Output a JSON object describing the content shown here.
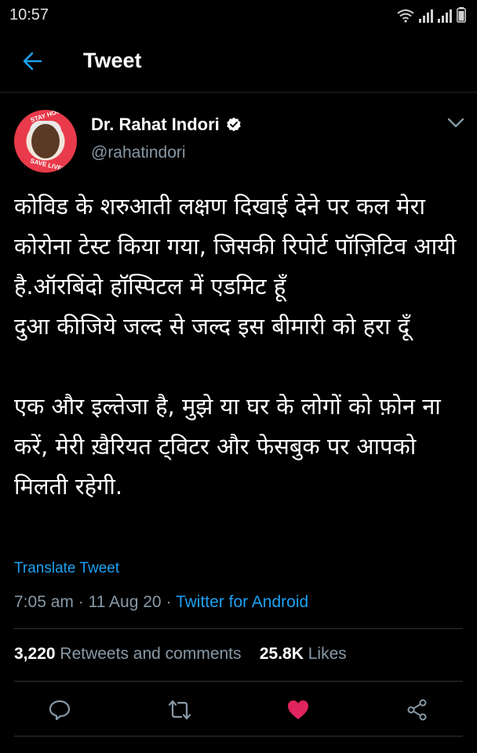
{
  "status_bar": {
    "time": "10:57"
  },
  "header": {
    "title": "Tweet"
  },
  "author": {
    "name": "Dr. Rahat Indori",
    "handle": "@rahatindori",
    "avatar_ring_text_top": "STAY HOME",
    "avatar_ring_text_bottom": "SAVE LIVES"
  },
  "tweet": {
    "paragraph1": "कोविड के शरुआती लक्षण दिखाई देने पर कल मेरा कोरोना टेस्ट किया गया, जिसकी रिपोर्ट पॉज़िटिव आयी है.ऑरबिंदो हॉस्पिटल में एडमिट हूँ\nदुआ कीजिये जल्द से जल्द इस बीमारी को हरा दूँ",
    "paragraph2": "एक और इल्तेजा है, मुझे या घर के लोगों को फ़ोन ना करें, मेरी ख़ैरियत ट्विटर और फेसबुक पर आपको मिलती रहेगी.",
    "translate_label": "Translate Tweet",
    "time": "7:05 am",
    "separator": "·",
    "date": "11 Aug 20",
    "source": "Twitter for Android"
  },
  "stats": {
    "retweets_count": "3,220",
    "retweets_label": "Retweets and comments",
    "likes_count": "25.8K",
    "likes_label": "Likes"
  },
  "icons": {
    "back": "arrow-left-icon",
    "verified": "verified-badge-icon",
    "more": "chevron-down-icon",
    "reply": "comment-icon",
    "retweet": "retweet-icon",
    "like": "heart-icon",
    "share": "share-icon"
  },
  "colors": {
    "accent": "#1da1f2",
    "like": "#e0245e",
    "muted": "#8899a6",
    "background": "#000000"
  }
}
